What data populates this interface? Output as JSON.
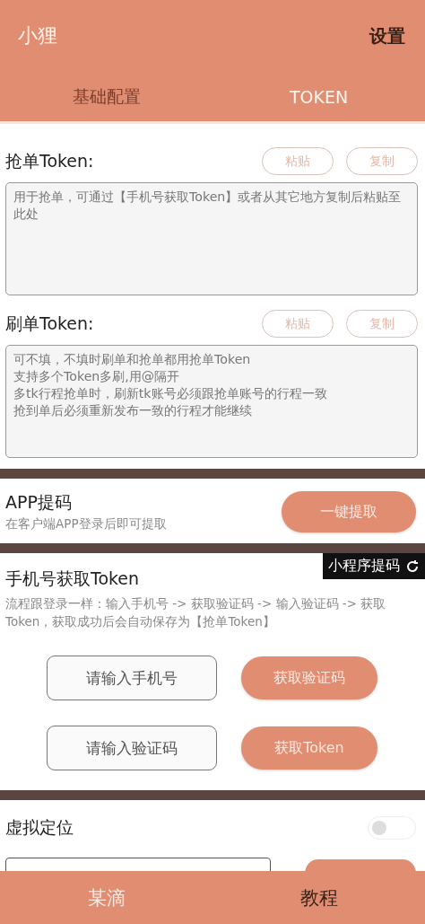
{
  "header": {
    "title": "小狸",
    "action": "设置"
  },
  "tabs": [
    {
      "label": "基础配置",
      "selected": false
    },
    {
      "label": "TOKEN",
      "selected": true
    }
  ],
  "token_fields": [
    {
      "label": "抢单Token:",
      "paste": "粘贴",
      "copy": "复制",
      "placeholder": [
        "用于抢单，可通过【手机号获取Token】或者从其它地方复制后粘贴至此处"
      ]
    },
    {
      "label": "刷单Token:",
      "paste": "粘贴",
      "copy": "复制",
      "placeholder": [
        "可不填，不填时刷单和抢单都用抢单Token",
        "支持多个Token多刷,用@隔开",
        "多tk行程抢单时，刷新tk账号必须跟抢单账号的行程一致",
        "抢到单后必须重新发布一致的行程才能继续"
      ]
    }
  ],
  "app_extract": {
    "title": "APP提码",
    "subtitle": "在客户端APP登录后即可提取",
    "button": "一键提取"
  },
  "mini_program_badge": {
    "label": "小程序提码"
  },
  "phone_token": {
    "title": "手机号获取Token",
    "description": "流程跟登录一样：输入手机号 -> 获取验证码 -> 输入验证码 -> 获取Token，获取成功后会自动保存为【抢单Token】",
    "rows": [
      {
        "placeholder": "请输入手机号",
        "button": "获取验证码"
      },
      {
        "placeholder": "请输入验证码",
        "button": "获取Token"
      }
    ]
  },
  "virtual_location": {
    "label": "虚拟定位",
    "on": false
  },
  "bottom_nav": [
    {
      "label": "某滴",
      "selected": true
    },
    {
      "label": "教程",
      "selected": false
    }
  ]
}
